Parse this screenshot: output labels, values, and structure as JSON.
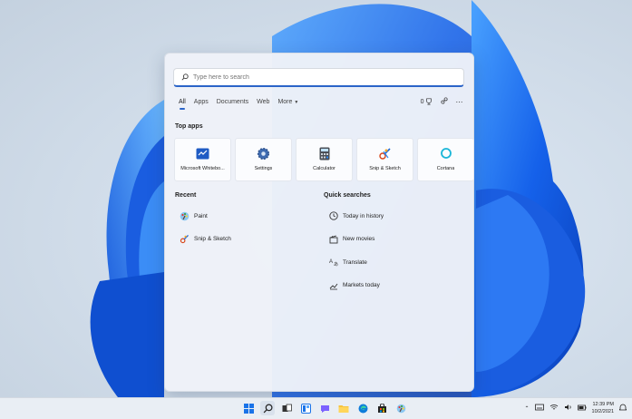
{
  "search": {
    "placeholder": "Type here to search"
  },
  "tabs": [
    {
      "label": "All",
      "active": true
    },
    {
      "label": "Apps"
    },
    {
      "label": "Documents"
    },
    {
      "label": "Web"
    },
    {
      "label": "More"
    }
  ],
  "header_right": {
    "points": "0",
    "trophy_icon": "trophy-icon",
    "share_icon": "share-icon",
    "more_icon": "ellipsis-icon"
  },
  "top_apps": {
    "title": "Top apps",
    "items": [
      {
        "label": "Microsoft Whitebo...",
        "icon": "whiteboard-icon"
      },
      {
        "label": "Settings",
        "icon": "gear-icon"
      },
      {
        "label": "Calculator",
        "icon": "calculator-icon"
      },
      {
        "label": "Snip & Sketch",
        "icon": "snip-sketch-icon"
      },
      {
        "label": "Cortana",
        "icon": "cortana-icon"
      }
    ]
  },
  "recent": {
    "title": "Recent",
    "items": [
      {
        "label": "Paint",
        "icon": "paint-icon"
      },
      {
        "label": "Snip & Sketch",
        "icon": "snip-sketch-icon"
      }
    ]
  },
  "quick_searches": {
    "title": "Quick searches",
    "items": [
      {
        "label": "Today in history",
        "icon": "clock-icon"
      },
      {
        "label": "New movies",
        "icon": "movie-icon"
      },
      {
        "label": "Translate",
        "icon": "translate-icon"
      },
      {
        "label": "Markets today",
        "icon": "chart-icon"
      }
    ]
  },
  "taskbar": {
    "icons": [
      "windows-icon",
      "search-icon",
      "task-view-icon",
      "widgets-icon",
      "chat-icon",
      "file-explorer-icon",
      "edge-icon",
      "store-icon",
      "paint-icon"
    ]
  },
  "tray": {
    "time": "12:39 PM",
    "date": "10/2/2021"
  },
  "colors": {
    "accent": "#2b64c8",
    "wallpaper_blue": "#1560e8"
  }
}
